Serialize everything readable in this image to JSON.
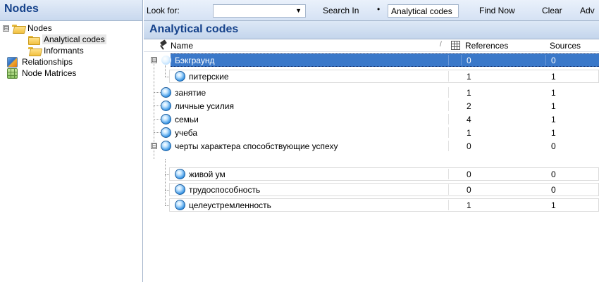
{
  "nav": {
    "title": "Nodes",
    "tree": [
      {
        "label": "Nodes",
        "expander": "⊟"
      },
      {
        "label": "Analytical codes"
      },
      {
        "label": "Informants"
      },
      {
        "label": "Relationships"
      },
      {
        "label": "Node Matrices"
      }
    ]
  },
  "findbar": {
    "look_for_label": "Look for:",
    "look_for_value": "",
    "search_in_label": "Search In",
    "search_in_marker": "•",
    "scope_value": "Analytical codes",
    "find_now_label": "Find Now",
    "clear_label": "Clear",
    "advanced_label": "Adv"
  },
  "list": {
    "title": "Analytical codes",
    "columns": {
      "name": "Name",
      "sort_marker": "/",
      "references": "References",
      "sources": "Sources"
    },
    "rows": [
      {
        "name": "Бэкграунд",
        "references": "0",
        "sources": "0"
      },
      {
        "name": "питерские",
        "references": "1",
        "sources": "1"
      },
      {
        "name": "занятие",
        "references": "1",
        "sources": "1"
      },
      {
        "name": "личные усилия",
        "references": "2",
        "sources": "1"
      },
      {
        "name": "семьи",
        "references": "4",
        "sources": "1"
      },
      {
        "name": "учеба",
        "references": "1",
        "sources": "1"
      },
      {
        "name": "черты характера способствующие успеху",
        "references": "0",
        "sources": "0"
      },
      {
        "name": "живой ум",
        "references": "0",
        "sources": "0"
      },
      {
        "name": "трудоспособность",
        "references": "0",
        "sources": "0"
      },
      {
        "name": "целеустремленность",
        "references": "1",
        "sources": "1"
      }
    ],
    "expander_collapse": "⊟"
  },
  "colors": {
    "header_text": "#15428b",
    "selection": "#3a78c9"
  }
}
